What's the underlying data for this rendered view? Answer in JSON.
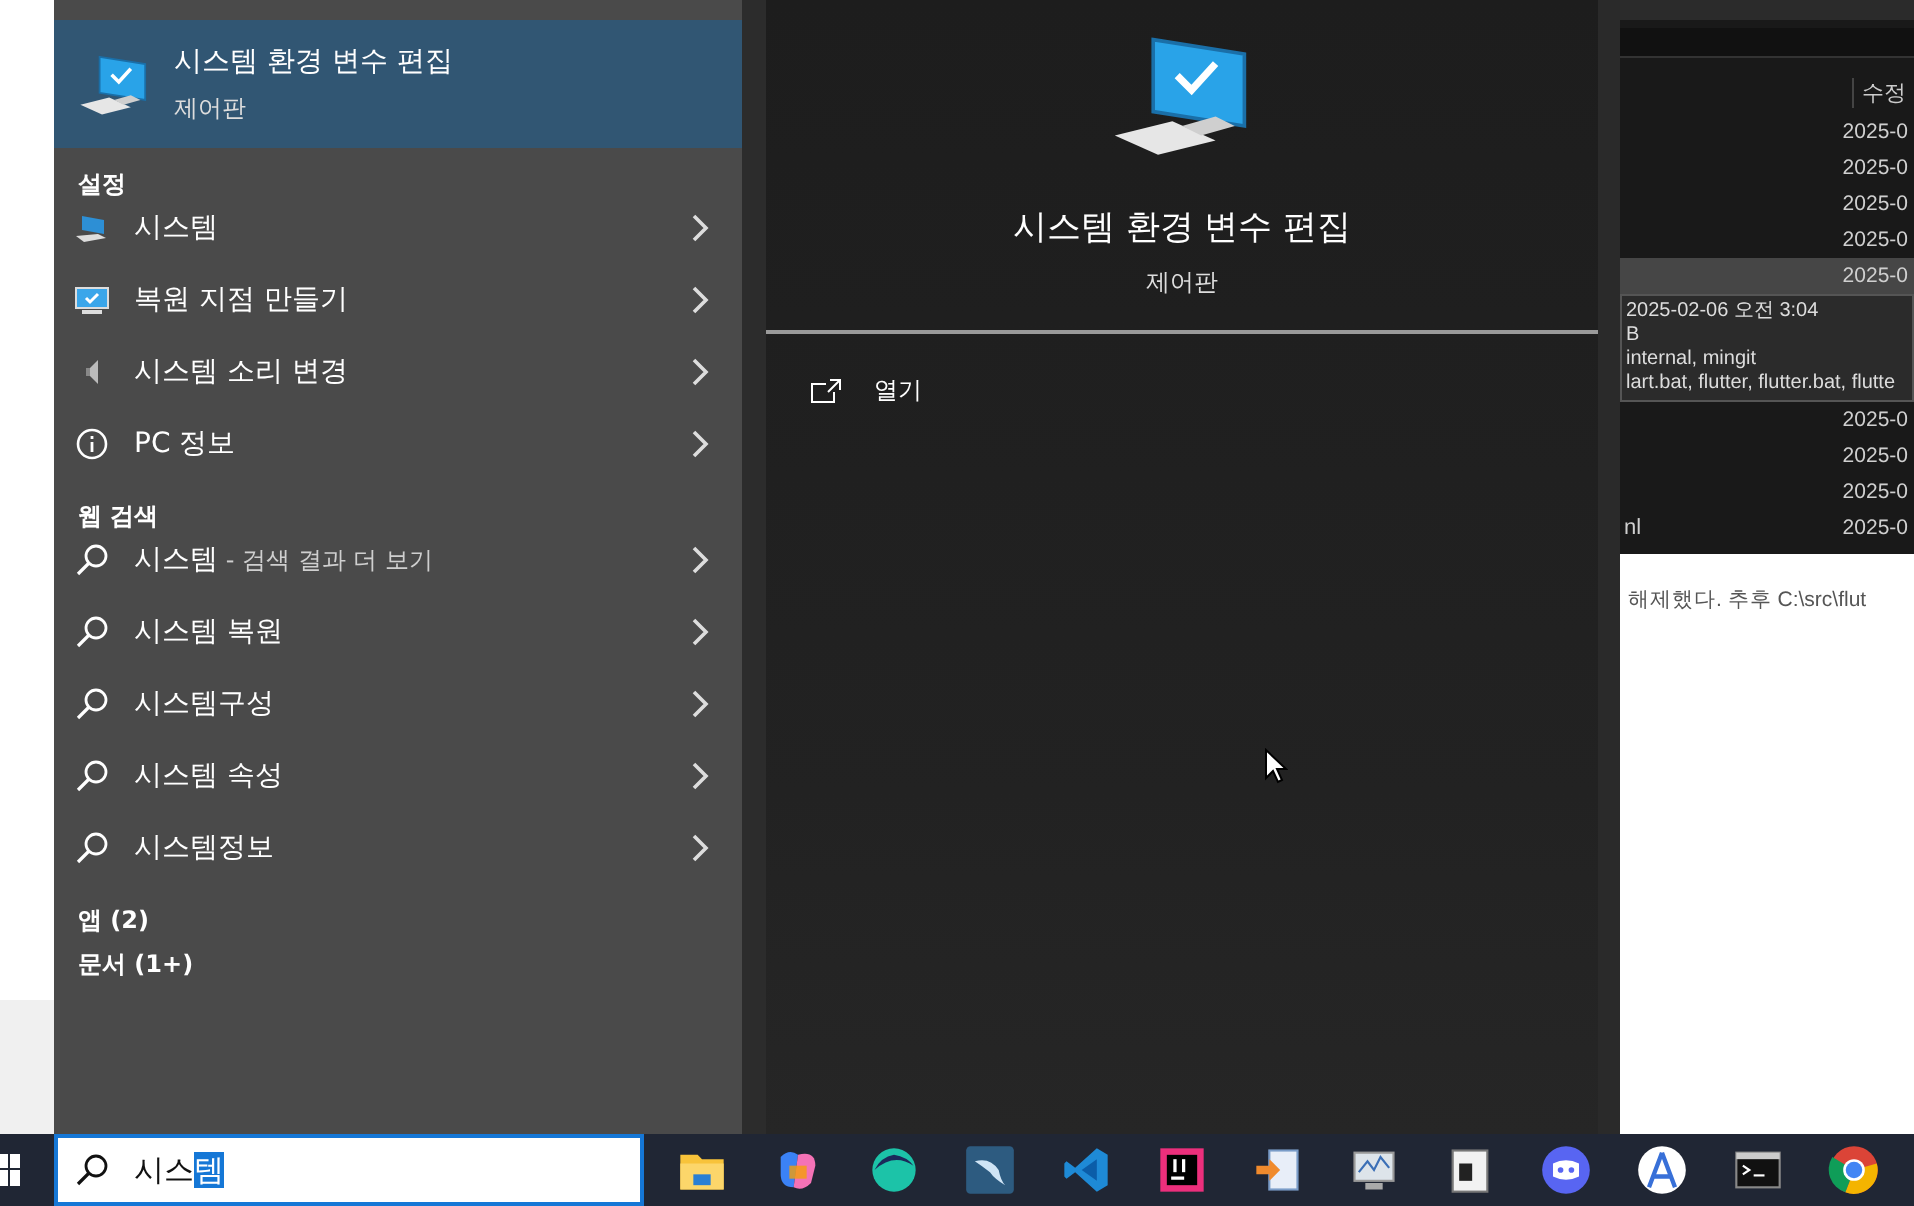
{
  "background": {
    "explorer": {
      "column_header": "수정",
      "rows_above": [
        {
          "date": "2025-0",
          "selected": false
        },
        {
          "date": "2025-0",
          "selected": false
        },
        {
          "date": "2025-0",
          "selected": false
        },
        {
          "date": "2025-0",
          "selected": false
        },
        {
          "date": "2025-0",
          "selected": true
        }
      ],
      "tooltip": [
        "2025-02-06 오전 3:04",
        "B",
        "internal, mingit",
        "lart.bat, flutter, flutter.bat, flutte"
      ],
      "rows_below": [
        {
          "date": "2025-0"
        },
        {
          "date": "2025-0"
        },
        {
          "date": "2025-0"
        },
        {
          "name": "nl",
          "date": "2025-0"
        }
      ]
    },
    "document_text": "해제했다. 추후 C:\\src\\flut"
  },
  "best_match": {
    "title": "시스템 환경 변수 편집",
    "subtitle": "제어판",
    "selected": true
  },
  "sections": [
    {
      "title": "설정",
      "items": [
        {
          "kind": "system",
          "label": "시스템"
        },
        {
          "kind": "restore",
          "label": "복원 지점 만들기"
        },
        {
          "kind": "sound",
          "label": "시스템 소리 변경"
        },
        {
          "kind": "info",
          "label": "PC 정보"
        }
      ]
    },
    {
      "title": "웹 검색",
      "items": [
        {
          "kind": "search",
          "label": "시스템",
          "suffix": " - 검색 결과 더 보기"
        },
        {
          "kind": "search",
          "label": "시스템 복원"
        },
        {
          "kind": "search",
          "label": "시스템구성"
        },
        {
          "kind": "search",
          "label": "시스템 속성"
        },
        {
          "kind": "search",
          "label": "시스템정보"
        }
      ]
    },
    {
      "title": "앱 (2)"
    },
    {
      "title": "문서 (1+)"
    }
  ],
  "preview": {
    "title": "시스템 환경 변수 편집",
    "subtitle": "제어판",
    "actions": [
      {
        "label": "열기"
      }
    ]
  },
  "taskbar": {
    "search": {
      "typed": "시스",
      "selected_text": "템"
    },
    "apps": [
      {
        "kind": "folder"
      },
      {
        "kind": "copilot"
      },
      {
        "kind": "whale"
      },
      {
        "kind": "dolphin"
      },
      {
        "kind": "vscode"
      },
      {
        "kind": "ij"
      },
      {
        "kind": "docs"
      },
      {
        "kind": "monitor"
      },
      {
        "kind": "notepad"
      },
      {
        "kind": "discord"
      },
      {
        "kind": "studio"
      },
      {
        "kind": "terminal"
      },
      {
        "kind": "chrome"
      }
    ]
  }
}
